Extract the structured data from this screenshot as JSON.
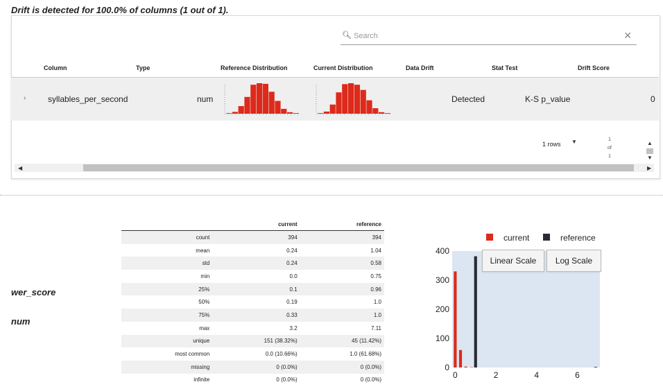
{
  "headline": "Drift is detected for 100.0% of columns (1 out of 1).",
  "search": {
    "placeholder": "Search",
    "icon": "search-icon",
    "clear_icon": "close-icon"
  },
  "columns": [
    "Column",
    "Type",
    "Reference Distribution",
    "Current Distribution",
    "Data Drift",
    "Stat Test",
    "Drift Score"
  ],
  "row": {
    "expand_icon": "chevron-right-icon",
    "column": "syllables_per_second",
    "type": "num",
    "data_drift": "Detected",
    "stat_test": "K-S p_value",
    "drift_score": "0"
  },
  "sparklines": {
    "reference_bins": [
      0.02,
      0.06,
      0.25,
      0.55,
      0.95,
      1.0,
      0.98,
      0.72,
      0.42,
      0.16,
      0.05,
      0.02
    ],
    "current_bins": [
      0.02,
      0.07,
      0.3,
      0.7,
      0.97,
      1.0,
      0.95,
      0.78,
      0.44,
      0.18,
      0.05,
      0.02
    ]
  },
  "footer": {
    "rows_label": "1 rows",
    "page_current": "1",
    "page_of": "of",
    "page_total": "1"
  },
  "feature": {
    "name": "wer_score",
    "type": "num"
  },
  "stats": {
    "headers": [
      "current",
      "reference"
    ],
    "rows": [
      [
        "count",
        "394",
        "394"
      ],
      [
        "mean",
        "0.24",
        "1.04"
      ],
      [
        "std",
        "0.24",
        "0.58"
      ],
      [
        "min",
        "0.0",
        "0.75"
      ],
      [
        "25%",
        "0.1",
        "0.96"
      ],
      [
        "50%",
        "0.19",
        "1.0"
      ],
      [
        "75%",
        "0.33",
        "1.0"
      ],
      [
        "max",
        "3.2",
        "7.11"
      ],
      [
        "unique",
        "151 (38.32%)",
        "45 (11.42%)"
      ],
      [
        "most common",
        "0.0 (10.66%)",
        "1.0 (61.68%)"
      ],
      [
        "missing",
        "0 (0.0%)",
        "0 (0.0%)"
      ],
      [
        "infinite",
        "0 (0.0%)",
        "0 (0.0%)"
      ]
    ]
  },
  "buttons": {
    "linear": "Linear Scale",
    "log": "Log Scale"
  },
  "chart_data": {
    "type": "bar",
    "legend": [
      {
        "name": "current",
        "color": "#dd2a1b"
      },
      {
        "name": "reference",
        "color": "#2b2b33"
      }
    ],
    "series": [
      {
        "name": "current",
        "x": [
          0.0,
          0.26,
          0.52,
          0.8,
          1.05
        ],
        "values": [
          330,
          60,
          3,
          1,
          0
        ]
      },
      {
        "name": "reference",
        "x": [
          0.1,
          1.0,
          6.9
        ],
        "values": [
          0,
          382,
          2
        ]
      }
    ],
    "xlim": [
      -0.15,
      7.11
    ],
    "ylim": [
      0,
      400
    ],
    "xticks": [
      "0",
      "2",
      "4",
      "6"
    ],
    "yticks": [
      "0",
      "100",
      "200",
      "300",
      "400"
    ],
    "grid": false,
    "legend_position": "top-right",
    "background": "#dce6f2"
  }
}
